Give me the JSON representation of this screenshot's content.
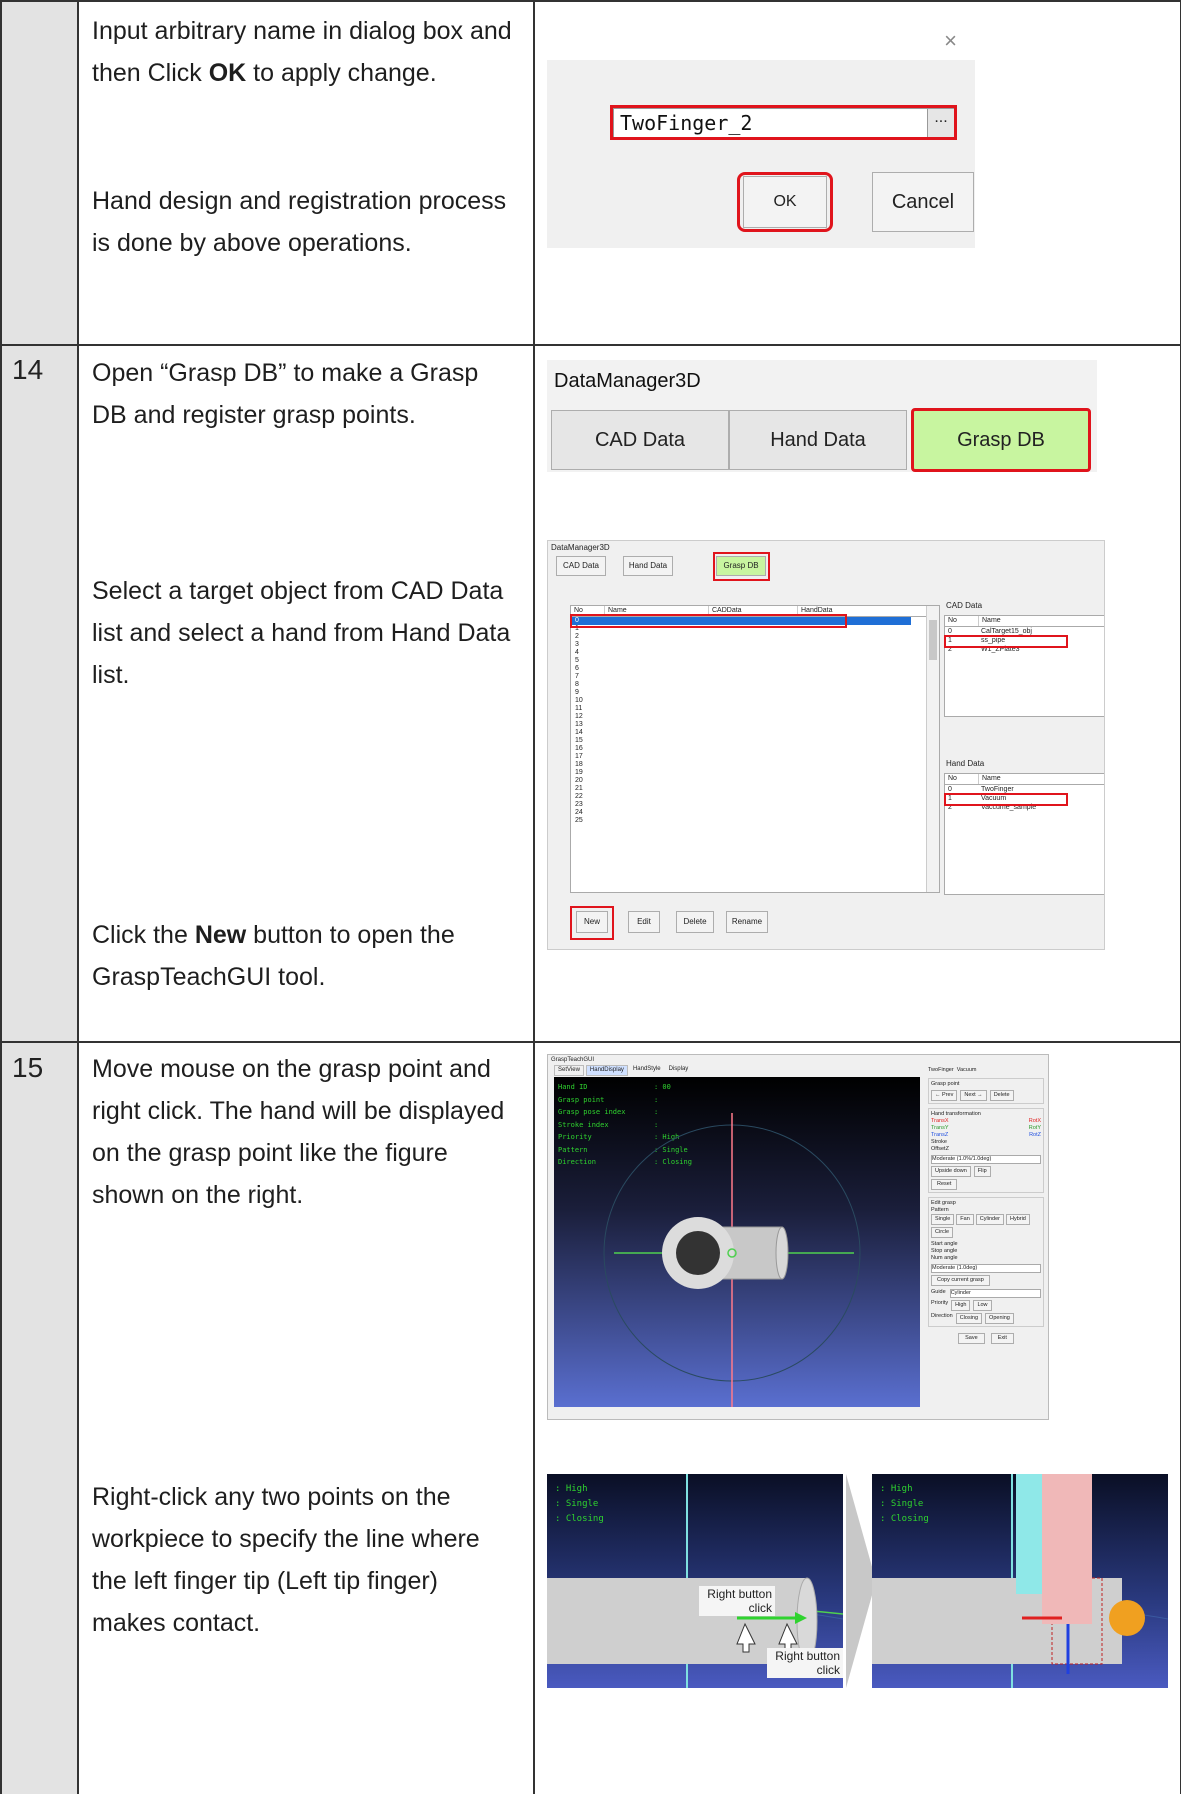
{
  "step13": {
    "text1_pre": "Input arbitrary name in dialog box and then Click ",
    "text1_bold": "OK",
    "text1_post": " to apply change.",
    "text2": "Hand design and registration process is done by above operations.",
    "dialog": {
      "close": "×",
      "input_value": "TwoFinger_2",
      "browse": "...",
      "ok": "OK",
      "cancel": "Cancel"
    }
  },
  "step14": {
    "number": "14",
    "text1": "Open “Grasp DB” to make a Grasp DB and register grasp points.",
    "text2": "Select a target object from CAD Data list and select a hand from Hand Data list.",
    "text3_pre": "Click the ",
    "text3_bold": "New",
    "text3_post": " button to open the GraspTeachGUI tool.",
    "dm_title": "DataManager3D",
    "tabs": [
      "CAD Data",
      "Hand Data",
      "Grasp DB"
    ],
    "grasp_table_headers": [
      "No",
      "Name",
      "CADData",
      "HandData"
    ],
    "grasp_rows": [
      "0",
      "1",
      "2",
      "3",
      "4",
      "5",
      "6",
      "7",
      "8",
      "9",
      "10",
      "11",
      "12",
      "13",
      "14",
      "15",
      "16",
      "17",
      "18",
      "19",
      "20",
      "21",
      "22",
      "23",
      "24",
      "25"
    ],
    "cad_panel_title": "CAD Data",
    "cad_headers": [
      "No",
      "Name"
    ],
    "cad_rows": [
      [
        "0",
        "CalTarget15_obj"
      ],
      [
        "1",
        "ss_pipe"
      ],
      [
        "2",
        "W1_ZPlate3"
      ]
    ],
    "hand_panel_title": "Hand Data",
    "hand_headers": [
      "No",
      "Name"
    ],
    "hand_rows": [
      [
        "0",
        "TwoFinger"
      ],
      [
        "1",
        "Vacuum"
      ],
      [
        "2",
        "Vaccume_sample"
      ]
    ],
    "buttons": [
      "New",
      "Edit",
      "Delete",
      "Rename"
    ]
  },
  "step15": {
    "number": "15",
    "text1": "Move mouse on the grasp point and right click. The hand will be displayed on the grasp point like the figure shown on the right.",
    "text2": "Right-click any two points on the workpiece to specify the line where the left finger tip (Left tip finger) makes contact.",
    "gui_title": "GraspTeachGUI",
    "gui_tabs": [
      "SetView",
      "HandDisplay",
      "HandStyle",
      "Display"
    ],
    "right_tabs": [
      "TwoFinger",
      "Vacuum"
    ],
    "overlay": [
      [
        "Hand ID",
        ": 00"
      ],
      [
        "Grasp point",
        ":"
      ],
      [
        "Grasp pose index",
        ":"
      ],
      [
        "Stroke index",
        ":"
      ],
      [
        "Priority",
        ": High"
      ],
      [
        "Pattern",
        ": Single"
      ],
      [
        "Direction",
        ": Closing"
      ]
    ],
    "panel": {
      "grasp_point": "Grasp point",
      "prev": "← Prev",
      "next": "Next →",
      "delete": "Delete",
      "hand_transformation": "Hand transformation",
      "trans": [
        "TransX",
        "TransY",
        "TransZ"
      ],
      "rot": [
        "RotX",
        "RotY",
        "RotZ"
      ],
      "stroke": "Stroke",
      "offsetz": "OffsetZ",
      "moderate1": "Moderate (1.0%/1.0deg)",
      "upside_down": "Upside down",
      "flip": "Flip",
      "reset": "Reset",
      "edit_grasp": "Edit grasp",
      "pattern": "Pattern",
      "patterns": [
        "Single",
        "Fan",
        "Cylinder",
        "Hybrid",
        "Circle"
      ],
      "start_angle": "Start angle",
      "stop_angle": "Stop angle",
      "num_angle": "Num angle",
      "moderate2": "Moderate (1.0deg)",
      "copy_current": "Copy current grasp",
      "guide": "Guide",
      "guide_value": "Cylinder",
      "priority": "Priority",
      "high": "High",
      "low": "Low",
      "direction": "Direction",
      "closing": "Closing",
      "opening": "Opening",
      "save": "Save",
      "exit": "Exit"
    },
    "small_overlay": [
      ": High",
      ": Single",
      ": Closing"
    ],
    "callout1": "Right button click",
    "callout2": "Right button click"
  },
  "colors": {
    "accent_red": "#e0141c",
    "tab_green": "#c8f5a0",
    "gl_blue_top": "#000000",
    "gl_blue_bottom": "#5a6fd0",
    "overlay_green": "#2fd32f"
  }
}
